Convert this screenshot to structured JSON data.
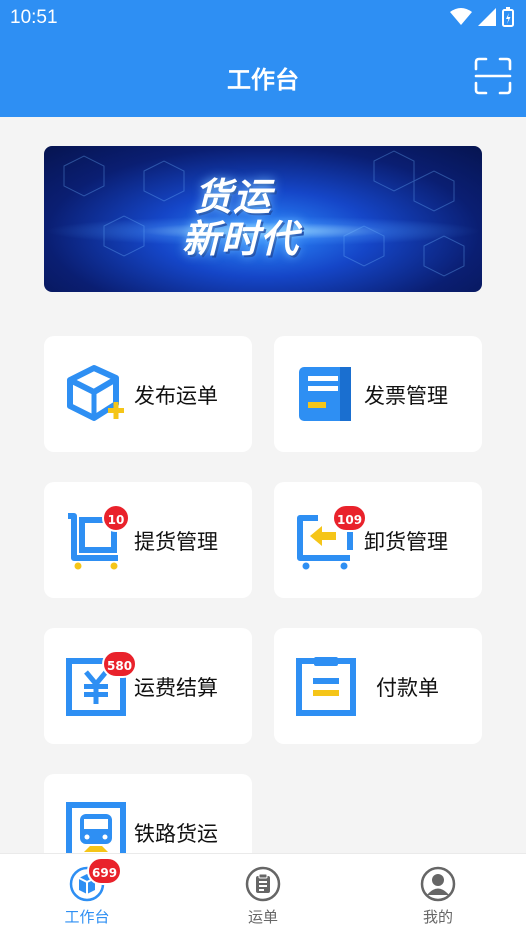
{
  "status": {
    "time": "10:51"
  },
  "header": {
    "title": "工作台"
  },
  "banner": {
    "line1": "货运",
    "line2": "新时代"
  },
  "menu": [
    {
      "label": "发布运单"
    },
    {
      "label": "发票管理"
    },
    {
      "label": "提货管理",
      "badge": "10"
    },
    {
      "label": "卸货管理",
      "badge": "109"
    },
    {
      "label": "运费结算",
      "badge": "580"
    },
    {
      "label": "付款单"
    },
    {
      "label": "铁路货运"
    }
  ],
  "tabs": [
    {
      "label": "工作台",
      "badge": "699",
      "active": true
    },
    {
      "label": "运单"
    },
    {
      "label": "我的"
    }
  ],
  "colors": {
    "primary": "#2e8ff3",
    "accent": "#f5c518",
    "badge": "#e9222b"
  }
}
